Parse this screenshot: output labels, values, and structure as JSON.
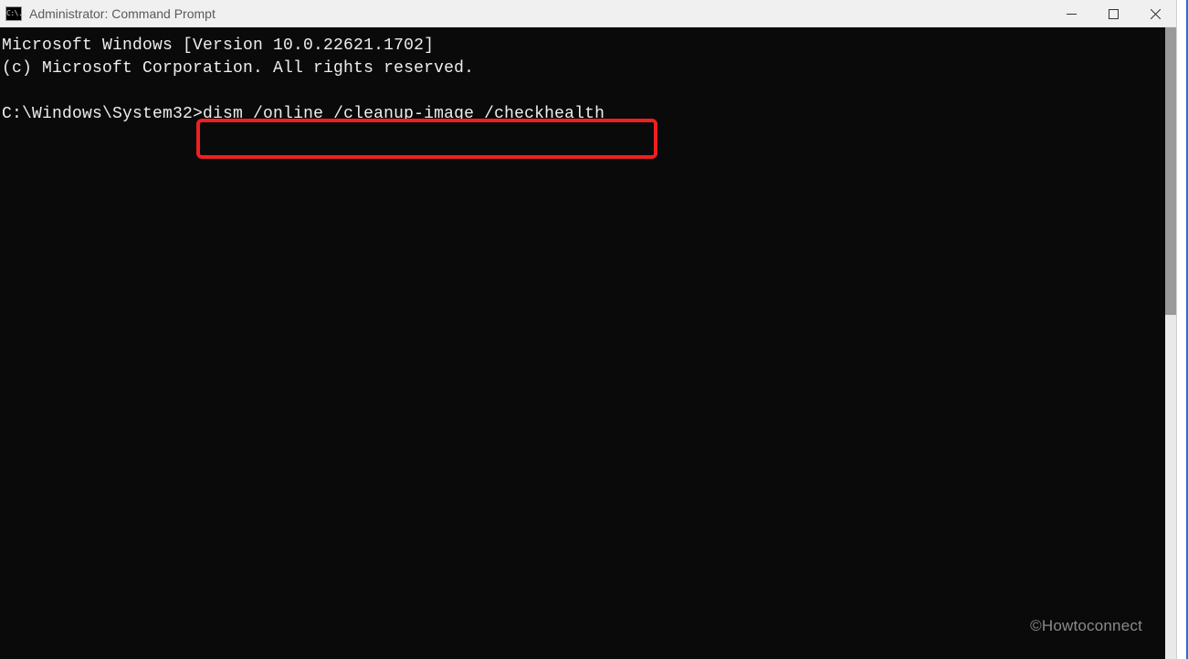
{
  "titlebar": {
    "icon_text": "C:\\..",
    "title": "Administrator: Command Prompt"
  },
  "controls": {
    "minimize_name": "minimize",
    "maximize_name": "maximize",
    "close_name": "close"
  },
  "terminal": {
    "line1": "Microsoft Windows [Version 10.0.22621.1702]",
    "line2": "(c) Microsoft Corporation. All rights reserved.",
    "blank": "",
    "prompt": "C:\\Windows\\System32>",
    "command": "dism /online /cleanup-image /checkhealth"
  },
  "watermark": "©Howtoconnect"
}
